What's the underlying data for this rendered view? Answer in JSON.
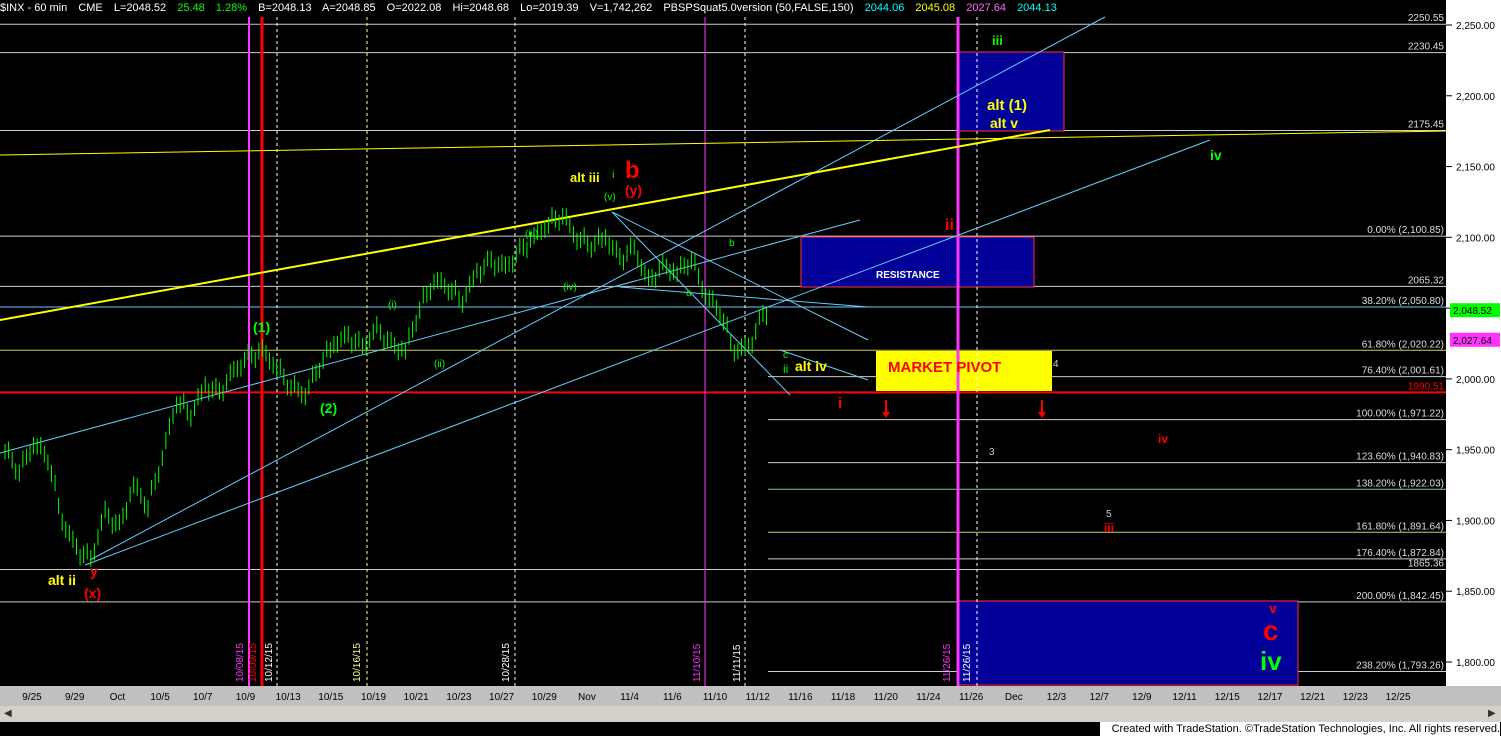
{
  "header": {
    "symbol": "$INX - 60 min",
    "exchange": "CME",
    "last": "L=2048.52",
    "change": "25.48",
    "pct": "1.28%",
    "bid": "B=2048.13",
    "ask": "A=2048.85",
    "open": "O=2022.08",
    "high": "Hi=2048.68",
    "low": "Lo=2019.39",
    "volume": "V=1,742,262",
    "indicator": "PBSPSquat5.0version (50,FALSE,150)",
    "ind_v1": "2044.06",
    "ind_v2": "2045.08",
    "ind_v3": "2027.64",
    "ind_v4": "2044.13"
  },
  "footer": "Created with TradeStation. ©TradeStation Technologies, Inc. All rights reserved.",
  "colors": {
    "background": "#000000",
    "price_bar": "#00ff00",
    "channel": "#66ccff",
    "trendline": "#ffff00",
    "red": "#ff0000",
    "magenta": "#ff33ff",
    "box": "#000099"
  },
  "chart_data": {
    "type": "bar",
    "title": "$INX - 60 min",
    "ylim": [
      1775,
      2265
    ],
    "y_ticks": [
      "2,250.00",
      "2,200.00",
      "2,150.00",
      "2,100.00",
      "2,050.00",
      "2,000.00",
      "1,950.00",
      "1,900.00",
      "1,850.00",
      "1,800.00"
    ],
    "y_tick_values": [
      2250,
      2200,
      2150,
      2100,
      2050,
      2000,
      1950,
      1900,
      1850,
      1800
    ],
    "x_ticks": [
      "9/25",
      "9/29",
      "Oct",
      "10/5",
      "10/7",
      "10/9",
      "10/13",
      "10/15",
      "10/19",
      "10/21",
      "10/23",
      "10/27",
      "10/29",
      "Nov",
      "11/4",
      "11/6",
      "11/10",
      "11/12",
      "11/16",
      "11/18",
      "11/20",
      "11/24",
      "11/26",
      "Dec",
      "12/3",
      "12/7",
      "12/9",
      "12/11",
      "12/15",
      "12/17",
      "12/21",
      "12/23",
      "12/25"
    ],
    "price_path": [
      {
        "x": 0,
        "y": 1950
      },
      {
        "x": 2,
        "y": 1935
      },
      {
        "x": 4,
        "y": 1955
      },
      {
        "x": 6,
        "y": 1945
      },
      {
        "x": 8,
        "y": 1900
      },
      {
        "x": 10,
        "y": 1880
      },
      {
        "x": 12,
        "y": 1872
      },
      {
        "x": 14,
        "y": 1905
      },
      {
        "x": 16,
        "y": 1895
      },
      {
        "x": 18,
        "y": 1925
      },
      {
        "x": 20,
        "y": 1910
      },
      {
        "x": 22,
        "y": 1945
      },
      {
        "x": 24,
        "y": 1985
      },
      {
        "x": 26,
        "y": 1975
      },
      {
        "x": 28,
        "y": 1995
      },
      {
        "x": 30,
        "y": 1990
      },
      {
        "x": 32,
        "y": 2005
      },
      {
        "x": 34,
        "y": 2015
      },
      {
        "x": 36,
        "y": 2020
      },
      {
        "x": 38,
        "y": 2008
      },
      {
        "x": 40,
        "y": 1995
      },
      {
        "x": 42,
        "y": 1990
      },
      {
        "x": 44,
        "y": 2010
      },
      {
        "x": 46,
        "y": 2025
      },
      {
        "x": 48,
        "y": 2030
      },
      {
        "x": 50,
        "y": 2022
      },
      {
        "x": 52,
        "y": 2035
      },
      {
        "x": 54,
        "y": 2024
      },
      {
        "x": 56,
        "y": 2020
      },
      {
        "x": 58,
        "y": 2050
      },
      {
        "x": 60,
        "y": 2070
      },
      {
        "x": 62,
        "y": 2065
      },
      {
        "x": 64,
        "y": 2055
      },
      {
        "x": 66,
        "y": 2075
      },
      {
        "x": 68,
        "y": 2083
      },
      {
        "x": 70,
        "y": 2078
      },
      {
        "x": 72,
        "y": 2090
      },
      {
        "x": 74,
        "y": 2100
      },
      {
        "x": 76,
        "y": 2110
      },
      {
        "x": 78,
        "y": 2116
      },
      {
        "x": 80,
        "y": 2100
      },
      {
        "x": 82,
        "y": 2095
      },
      {
        "x": 84,
        "y": 2100
      },
      {
        "x": 86,
        "y": 2085
      },
      {
        "x": 88,
        "y": 2092
      },
      {
        "x": 90,
        "y": 2068
      },
      {
        "x": 92,
        "y": 2080
      },
      {
        "x": 94,
        "y": 2075
      },
      {
        "x": 96,
        "y": 2085
      },
      {
        "x": 98,
        "y": 2060
      },
      {
        "x": 100,
        "y": 2048
      },
      {
        "x": 102,
        "y": 2020
      },
      {
        "x": 104,
        "y": 2022
      },
      {
        "x": 106,
        "y": 2045
      },
      {
        "x": 107,
        "y": 2048.52
      }
    ],
    "horizontal_levels": [
      {
        "label": "2250.55",
        "value": 2250.55,
        "color": "#cccccc"
      },
      {
        "label": "2230.45",
        "value": 2230.45,
        "color": "#cccccc"
      },
      {
        "label": "2175.45",
        "value": 2175.45,
        "color": "#cccccc"
      },
      {
        "label": "0.00% (2,100.85)",
        "value": 2100.85,
        "color": "#cccccc"
      },
      {
        "label": "2065.32",
        "value": 2065.32,
        "color": "#cccccc"
      },
      {
        "label": "38.20% (2,050.80)",
        "value": 2050.8,
        "color": "#66ccff"
      },
      {
        "label": "61.80% (2,020.22)",
        "value": 2020.22,
        "color": "#cccc66"
      },
      {
        "label": "76.40% (2,001.61)",
        "value": 2001.61,
        "color": "#cccccc"
      },
      {
        "label": "1990.51",
        "value": 1990.51,
        "color": "#ff0000"
      },
      {
        "label": "100.00% (1,971.22)",
        "value": 1971.22,
        "color": "#cccccc"
      },
      {
        "label": "123.60% (1,940.83)",
        "value": 1940.83,
        "color": "#cccccc"
      },
      {
        "label": "138.20% (1,922.03)",
        "value": 1922.03,
        "color": "#66cc99"
      },
      {
        "label": "161.80% (1,891.64)",
        "value": 1891.64,
        "color": "#cccc66"
      },
      {
        "label": "176.40% (1,872.84)",
        "value": 1872.84,
        "color": "#cccccc"
      },
      {
        "label": "1865.36",
        "value": 1865.36,
        "color": "#cccccc"
      },
      {
        "label": "200.00% (1,842.45)",
        "value": 1842.45,
        "color": "#cccccc"
      },
      {
        "label": "238.20% (1,793.26)",
        "value": 1793.26,
        "color": "#cccccc"
      }
    ],
    "right_badges": [
      {
        "label": "2,048.52",
        "value": 2048.52,
        "color": "#00ff00"
      },
      {
        "label": "2,027.64",
        "value": 2027.64,
        "color": "#ff33ff"
      }
    ],
    "annotations": [
      {
        "text": "alt ii",
        "color": "#ffff00"
      },
      {
        "text": "y",
        "color": "#ff0000"
      },
      {
        "text": "(x)",
        "color": "#ff0000"
      },
      {
        "text": "(1)",
        "color": "#00ff00"
      },
      {
        "text": "(2)",
        "color": "#00ff00"
      },
      {
        "text": "alt iii",
        "color": "#ffff00"
      },
      {
        "text": "b",
        "color": "#ff0000"
      },
      {
        "text": "(y)",
        "color": "#ff0000"
      },
      {
        "text": "i",
        "color": "#00ff00"
      },
      {
        "text": "(v)",
        "color": "#00ff00"
      },
      {
        "text": "(iii)",
        "color": "#00ff00"
      },
      {
        "text": "(iv)",
        "color": "#00ff00"
      },
      {
        "text": "(i)",
        "color": "#00ff00"
      },
      {
        "text": "(ii)",
        "color": "#00ff00"
      },
      {
        "text": "a",
        "color": "#00ff00"
      },
      {
        "text": "b",
        "color": "#00ff00"
      },
      {
        "text": "c",
        "color": "#00ff00"
      },
      {
        "text": "ii",
        "color": "#00ff00"
      },
      {
        "text": "alt iv",
        "color": "#ffff00"
      },
      {
        "text": "i",
        "color": "#ff0000"
      },
      {
        "text": "ii",
        "color": "#ff0000"
      },
      {
        "text": "iii",
        "color": "#00ff00"
      },
      {
        "text": "alt (1)",
        "color": "#ffff00"
      },
      {
        "text": "alt v",
        "color": "#ffff00"
      },
      {
        "text": "iv",
        "color": "#00ff00"
      },
      {
        "text": "RESISTANCE",
        "color": "#ffffff"
      },
      {
        "text": "MARKET PIVOT",
        "color": "#ff0000"
      },
      {
        "text": "4",
        "color": "#cccccc"
      },
      {
        "text": "3",
        "color": "#cccccc"
      },
      {
        "text": "iv",
        "color": "#ff0000"
      },
      {
        "text": "5",
        "color": "#cccccc"
      },
      {
        "text": "iii",
        "color": "#ff0000"
      },
      {
        "text": "v",
        "color": "#ff0000"
      },
      {
        "text": "c",
        "color": "#ff0000"
      },
      {
        "text": "iv",
        "color": "#00ff00"
      }
    ],
    "vertical_date_labels": [
      "10/08/15",
      "10/09/15",
      "10/12/15",
      "10/16/15",
      "10/28/15",
      "11/10/15",
      "11/11/15",
      "11/26/15",
      "11/26/15"
    ]
  }
}
